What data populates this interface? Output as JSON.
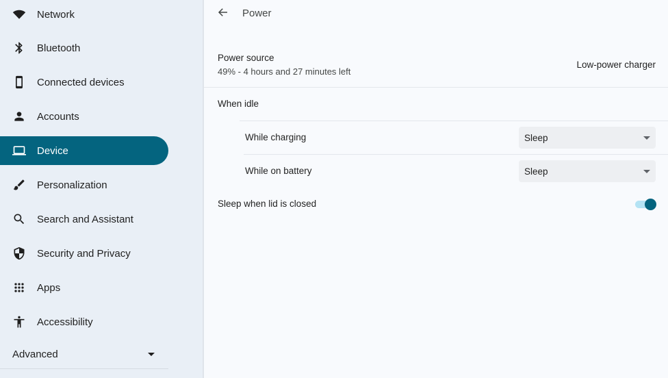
{
  "sidebar": {
    "items": [
      {
        "label": "Network",
        "icon": "wifi-icon"
      },
      {
        "label": "Bluetooth",
        "icon": "bluetooth-icon"
      },
      {
        "label": "Connected devices",
        "icon": "phone-icon"
      },
      {
        "label": "Accounts",
        "icon": "person-icon"
      },
      {
        "label": "Device",
        "icon": "laptop-icon",
        "selected": true
      },
      {
        "label": "Personalization",
        "icon": "brush-icon"
      },
      {
        "label": "Search and Assistant",
        "icon": "search-icon"
      },
      {
        "label": "Security and Privacy",
        "icon": "shield-icon"
      },
      {
        "label": "Apps",
        "icon": "apps-grid-icon"
      },
      {
        "label": "Accessibility",
        "icon": "accessibility-icon"
      }
    ],
    "advanced_label": "Advanced"
  },
  "header": {
    "title": "Power",
    "back_icon": "arrow-back-icon"
  },
  "power_source": {
    "label": "Power source",
    "status": "49% - 4 hours and 27 minutes left",
    "value": "Low-power charger"
  },
  "when_idle": {
    "label": "When idle",
    "while_charging": {
      "label": "While charging",
      "selected": "Sleep"
    },
    "while_on_battery": {
      "label": "While on battery",
      "selected": "Sleep"
    }
  },
  "lid": {
    "label": "Sleep when lid is closed",
    "enabled": true
  },
  "colors": {
    "accent": "#04647f",
    "toggle_track": "#b4e3f4",
    "sidebar_bg": "#e9eff6",
    "main_bg": "#f8fafd"
  }
}
